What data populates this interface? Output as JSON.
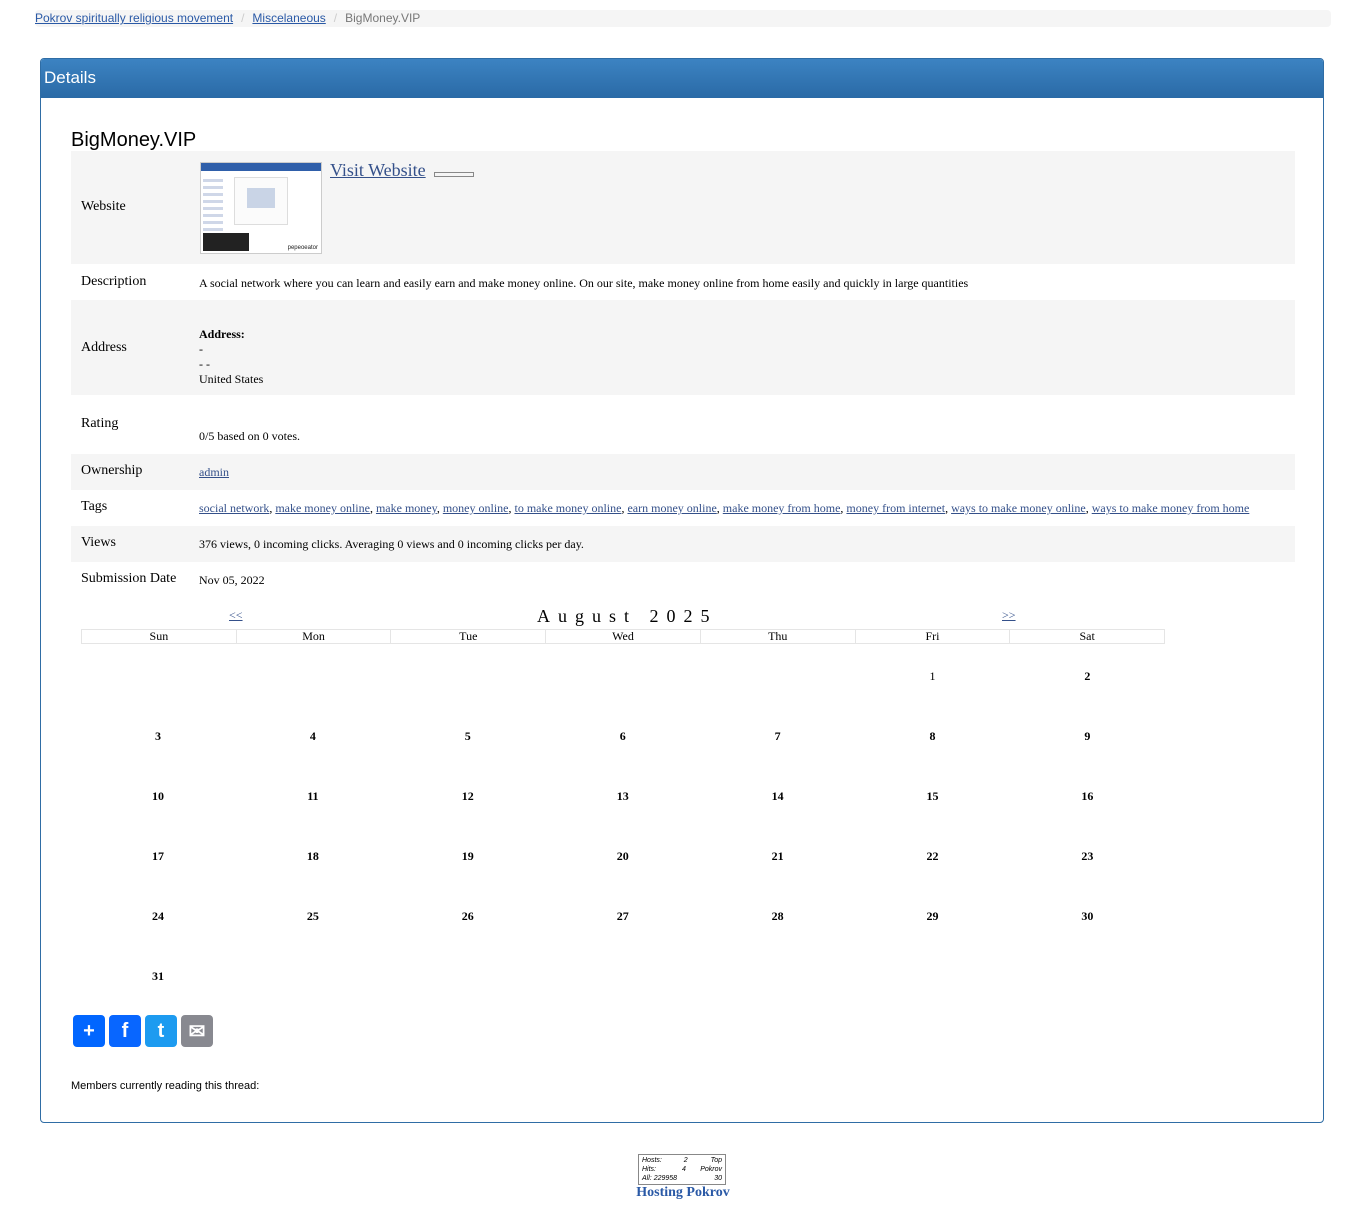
{
  "breadcrumb": {
    "home": "Pokrov spiritually religious movement",
    "section": "Miscelaneous",
    "current": "BigMoney.VIP"
  },
  "panel": {
    "header": "Details",
    "title": "BigMoney.VIP"
  },
  "details": {
    "website_label": "Website",
    "visit_link": "Visit Website",
    "thumbnail_logo": "pepeoeator",
    "description_label": "Description",
    "description": "A social network where you can learn and easily earn and make money online. On our site, make money online from home easily and quickly in large quantities",
    "address_label": "Address",
    "address_heading": "Address:",
    "address_line1": "-",
    "address_line2": "- -",
    "address_country": "United States",
    "rating_label": "Rating",
    "rating_text": "0/5 based on 0 votes.",
    "ownership_label": "Ownership",
    "owner": "admin",
    "tags_label": "Tags",
    "tags": [
      "social network",
      "make money online",
      "make money",
      "money online",
      "to make money online",
      "earn money online",
      "make money from home",
      "money from internet",
      "ways to make money online",
      "ways to make money from home"
    ],
    "views_label": "Views",
    "views_text": "376 views, 0 incoming clicks. Averaging 0 views and 0 incoming clicks per day.",
    "submission_label": "Submission Date",
    "submission_date": "Nov 05, 2022"
  },
  "calendar": {
    "prev": "<<",
    "next": ">>",
    "month_title": "August 2025",
    "weekdays": [
      "Sun",
      "Mon",
      "Tue",
      "Wed",
      "Thu",
      "Fri",
      "Sat"
    ],
    "first_weekday_index": 5,
    "days_in_month": 31
  },
  "share": {
    "buttons": [
      {
        "name": "share-button",
        "glyph": "+",
        "color": "#0166ff"
      },
      {
        "name": "facebook-button",
        "glyph": "f",
        "color": "#0866ff"
      },
      {
        "name": "twitter-button",
        "glyph": "t",
        "color": "#1d9bf0"
      },
      {
        "name": "email-button",
        "glyph": "✉",
        "color": "#888990"
      }
    ]
  },
  "members_text": "Members currently reading this thread:",
  "counter": {
    "hosts_label": "Hosts:",
    "hosts_value": "2",
    "hits_label": "Hits:",
    "hits_value": "4",
    "all_label": "All:",
    "all_value": "229958",
    "top_label": "Top",
    "top_site": "Pokrov",
    "top_rank": "30"
  },
  "footer": {
    "hosting": "Hosting Pokrov"
  }
}
